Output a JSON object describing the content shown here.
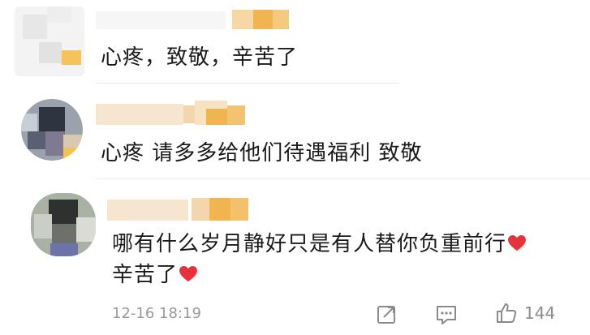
{
  "comments": [
    {
      "text": "心疼，致敬，辛苦了",
      "heart_at_end": false
    },
    {
      "text": "心疼 请多多给他们待遇福利 致敬",
      "heart_at_end": false
    },
    {
      "line1": "哪有什么岁月静好只是有人替你负重前行",
      "line2": "辛苦了",
      "heart_at_end": true
    }
  ],
  "footer": {
    "timestamp": "12-16 18:19",
    "like_count": "144"
  },
  "colors": {
    "heart": "#e8323b",
    "blur_orange": "#f0b450",
    "blur_light": "#f7e6cf"
  },
  "icons": [
    "share-icon",
    "comment-icon",
    "thumbs-up-icon",
    "heart-icon"
  ]
}
